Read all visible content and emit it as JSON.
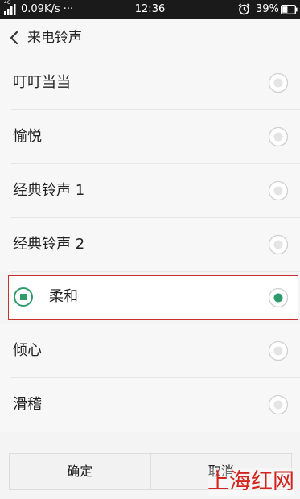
{
  "status_bar": {
    "network_type": "4G",
    "net_speed": "0.09K/s ···",
    "time": "12:36",
    "battery_percent": "39%",
    "signal_icon": "signal-icon",
    "alarm_icon": "alarm-clock-icon",
    "battery_icon": "battery-icon"
  },
  "header": {
    "back_icon": "chevron-left-icon",
    "title": "来电铃声"
  },
  "ringtones": [
    {
      "label": "叮叮当当",
      "selected": false
    },
    {
      "label": "愉悦",
      "selected": false
    },
    {
      "label": "经典铃声 1",
      "selected": false
    },
    {
      "label": "经典铃声 2",
      "selected": false
    },
    {
      "label": "柔和",
      "selected": true
    },
    {
      "label": "倾心",
      "selected": false
    },
    {
      "label": "滑稽",
      "selected": false
    }
  ],
  "buttons": {
    "confirm": "确定",
    "cancel": "取消"
  },
  "watermark": "上海红网",
  "colors": {
    "accent_green": "#2e9a6a",
    "focus_red": "#c9302c",
    "watermark_red": "#d3241f"
  }
}
